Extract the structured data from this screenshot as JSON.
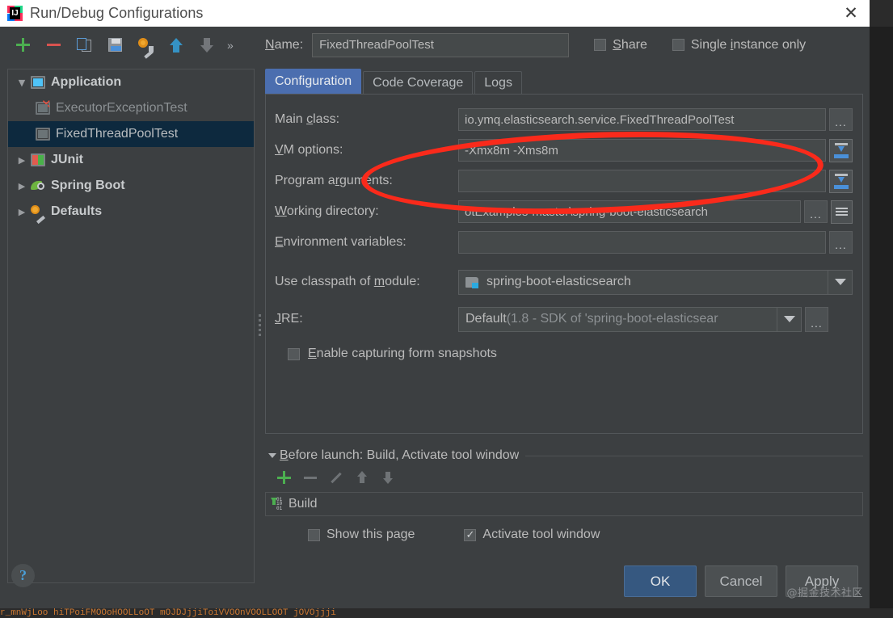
{
  "window": {
    "title": "Run/Debug Configurations",
    "close_icon": "✕",
    "app_icon": "intellij-idea-icon"
  },
  "toolbar": {
    "add_label": "+",
    "remove_label": "−",
    "copy_label": "copy",
    "save_label": "save",
    "settings_label": "settings",
    "move_up_label": "move up",
    "move_down_label": "move down",
    "more_label": "»"
  },
  "name_row": {
    "label": "Name:",
    "label_mnemonic": "N",
    "label_rest": "ame:",
    "value": "FixedThreadPoolTest",
    "placeholder": "",
    "share": {
      "label": "Share",
      "mnemonic": "S",
      "rest": "hare",
      "checked": false
    },
    "single_instance": {
      "label": "Single instance only",
      "pre": "Single ",
      "mnemonic": "i",
      "rest": "nstance only",
      "checked": false
    }
  },
  "tree": {
    "items": [
      {
        "label": "Application",
        "twisty": "▼",
        "icon": "application-icon",
        "style": "bold",
        "indent": 0,
        "selected": false
      },
      {
        "label": "ExecutorExceptionTest",
        "twisty": "",
        "icon": "run-config-error-icon",
        "style": "dim",
        "indent": 1,
        "selected": false
      },
      {
        "label": "FixedThreadPoolTest",
        "twisty": "",
        "icon": "run-config-icon",
        "style": "sel",
        "indent": 1,
        "selected": true
      },
      {
        "label": "JUnit",
        "twisty": "▶",
        "icon": "junit-icon",
        "style": "bold",
        "indent": 0,
        "selected": false
      },
      {
        "label": "Spring Boot",
        "twisty": "▶",
        "icon": "spring-boot-icon",
        "style": "bold",
        "indent": 0,
        "selected": false
      },
      {
        "label": "Defaults",
        "twisty": "▶",
        "icon": "defaults-gear-icon",
        "style": "bold",
        "indent": 0,
        "selected": false
      }
    ]
  },
  "tabs": [
    {
      "label": "Configuration",
      "active": true
    },
    {
      "label": "Code Coverage",
      "active": false
    },
    {
      "label": "Logs",
      "active": false
    }
  ],
  "form": {
    "main_class": {
      "label": "Main class:",
      "pre": "Main ",
      "mnemonic": "c",
      "rest": "lass:",
      "value": "io.ymq.elasticsearch.service.FixedThreadPoolTest",
      "browse_label": "..."
    },
    "vm_options": {
      "label": "VM options:",
      "pre": "",
      "mnemonic": "V",
      "rest": "M options:",
      "value": "-Xmx8m -Xms8m",
      "expand_label": "expand"
    },
    "program_arguments": {
      "label": "Program arguments:",
      "pre": "Program a",
      "mnemonic": "r",
      "rest": "guments:",
      "value": "",
      "expand_label": "expand"
    },
    "working_directory": {
      "label": "Working directory:",
      "pre": "",
      "mnemonic": "W",
      "rest": "orking directory:",
      "value": "otExamples-master\\spring-boot-elasticsearch",
      "browse_label": "...",
      "macros_label": "macros"
    },
    "environment_variables": {
      "label": "Environment variables:",
      "pre": "",
      "mnemonic": "E",
      "rest": "nvironment variables:",
      "value": "",
      "browse_label": "..."
    },
    "use_classpath_of_module": {
      "label": "Use classpath of module:",
      "pre": "Use classpath of ",
      "mnemonic": "m",
      "rest": "odule:",
      "value": "spring-boot-elasticsearch",
      "icon": "module-icon",
      "caret": "▼"
    },
    "jre": {
      "label": "JRE:",
      "pre": "",
      "mnemonic": "J",
      "rest": "RE:",
      "value_main": "Default ",
      "value_dim": "(1.8 - SDK of 'spring-boot-elasticsear",
      "caret": "▼",
      "browse_label": "..."
    },
    "enable_capturing": {
      "label": "Enable capturing form snapshots",
      "pre": "",
      "mnemonic": "E",
      "rest": "nable capturing form snapshots",
      "checked": false
    }
  },
  "before_launch": {
    "title": "Before launch: Build, Activate tool window",
    "title_mnemonic": "B",
    "title_rest": "efore launch: Build, Activate tool window",
    "twisty": "▼",
    "toolbar": {
      "add": "add",
      "remove": "remove",
      "edit": "edit",
      "move_up": "move up",
      "move_down": "move down"
    },
    "tasks": [
      {
        "label": "Build",
        "icon": "build-icon"
      }
    ],
    "show_this_page": {
      "label": "Show this page",
      "checked": false
    },
    "activate_tool_window": {
      "label": "Activate tool window",
      "checked": true
    }
  },
  "bottom": {
    "help_label": "?",
    "ok_label": "OK",
    "cancel_label": "Cancel",
    "apply_label": "Apply",
    "watermark": "@掘金技术社区"
  },
  "annotation": {
    "type": "red-ellipse-highlight",
    "color": "#fa2a1b"
  },
  "background_code": {
    "line": "r_mnWjLoo hiTPoiFMOOoHOOLLoOT  mOJDJjjiToiVVOOnVOOLLOOT  jOVOjjji"
  }
}
